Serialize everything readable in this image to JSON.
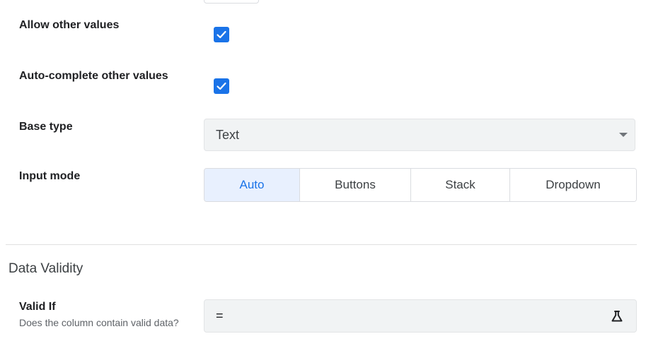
{
  "fields": {
    "allow_other": {
      "label": "Allow other values",
      "checked": true
    },
    "autocomplete_other": {
      "label": "Auto-complete other values",
      "checked": true
    },
    "base_type": {
      "label": "Base type",
      "value": "Text"
    },
    "input_mode": {
      "label": "Input mode",
      "options": [
        "Auto",
        "Buttons",
        "Stack",
        "Dropdown"
      ],
      "selected": "Auto"
    }
  },
  "data_validity": {
    "title": "Data Validity",
    "valid_if": {
      "label": "Valid If",
      "help": "Does the column contain valid data?",
      "value": "="
    }
  },
  "colors": {
    "accent": "#1a73e8",
    "selected_bg": "#e8f0fe",
    "field_bg": "#f1f3f4"
  },
  "icons": {
    "checkbox": "checkmark-icon",
    "select": "caret-down-icon",
    "formula": "flask-icon"
  }
}
